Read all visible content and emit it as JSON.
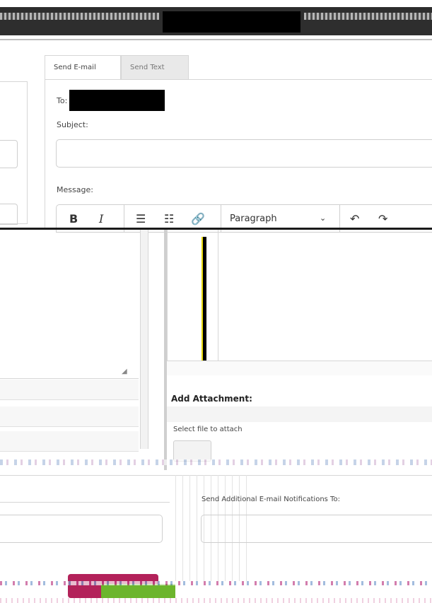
{
  "tabs": {
    "email": "Send E-mail",
    "text": "Send Text"
  },
  "form": {
    "to_label": "To:",
    "subject_label": "Subject:",
    "message_label": "Message:",
    "attachment_title": "Add Attachment:",
    "select_file_label": "Select file to attach",
    "notifications_label": "Send Additional E-mail Notifications To:"
  },
  "toolbar": {
    "bold": "B",
    "italic": "I",
    "bullet_list": "☰",
    "numbered_list": "☷",
    "link": "🔗",
    "block_format": "Paragraph",
    "chevron": "⌄",
    "undo": "↶",
    "redo": "↷"
  },
  "icons": {
    "resize_handle": "resize-grip-icon",
    "cursor": "text-cursor-icon"
  },
  "colors": {
    "primary_button": "#b3225a",
    "secondary_button": "#6cb52d"
  }
}
